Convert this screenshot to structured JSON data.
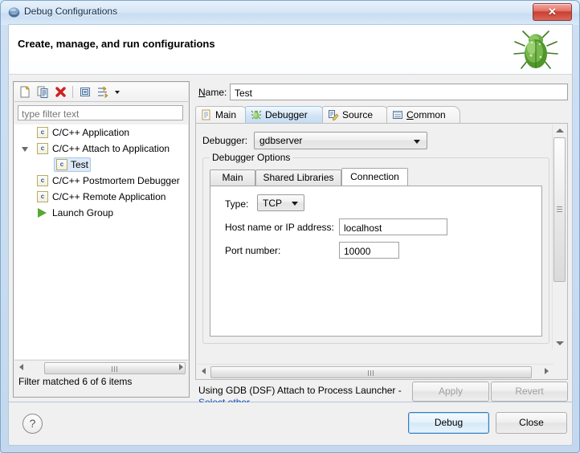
{
  "window": {
    "title": "Debug Configurations",
    "icon": "eclipse-sphere-icon",
    "close_label": "✕"
  },
  "banner": {
    "title": "Create, manage, and run configurations",
    "icon": "green-bug-icon"
  },
  "left_panel": {
    "toolbar": [
      {
        "name": "new-configuration-icon",
        "tooltip": "New launch configuration"
      },
      {
        "name": "duplicate-configuration-icon",
        "tooltip": "Duplicate"
      },
      {
        "name": "delete-configuration-icon",
        "tooltip": "Delete"
      },
      {
        "name": "collapse-all-icon",
        "tooltip": "Collapse All"
      },
      {
        "name": "filter-icon",
        "tooltip": "Filter launch configurations"
      },
      {
        "name": "chevron-down-icon",
        "tooltip": "View Menu"
      }
    ],
    "filter_placeholder": "type filter text",
    "filter_value": "",
    "tree": [
      {
        "label": "C/C++ Application",
        "icon": "c-config-icon",
        "indent": 0,
        "expandable": false,
        "selected": false
      },
      {
        "label": "C/C++ Attach to Application",
        "icon": "c-config-icon",
        "indent": 0,
        "expandable": true,
        "expanded": true,
        "selected": false
      },
      {
        "label": "Test",
        "icon": "c-config-icon",
        "indent": 1,
        "expandable": false,
        "selected": true
      },
      {
        "label": "C/C++ Postmortem Debugger",
        "icon": "c-config-icon",
        "indent": 0,
        "expandable": false,
        "selected": false
      },
      {
        "label": "C/C++ Remote Application",
        "icon": "c-config-icon",
        "indent": 0,
        "expandable": false,
        "selected": false
      },
      {
        "label": "Launch Group",
        "icon": "launch-group-icon",
        "indent": 0,
        "expandable": false,
        "selected": false
      }
    ],
    "status": "Filter matched 6 of 6 items"
  },
  "right_panel": {
    "name_label": "Name:",
    "name_value": "Test",
    "tabs": [
      {
        "label": "Main",
        "icon": "document-icon",
        "active": false
      },
      {
        "label": "Debugger",
        "icon": "bug-icon",
        "active": true
      },
      {
        "label": "Source",
        "icon": "source-icon",
        "active": false
      },
      {
        "label": "Common",
        "icon": "common-grid-icon",
        "active": false
      }
    ],
    "debugger_label": "Debugger:",
    "debugger_value": "gdbserver",
    "group_title": "Debugger Options",
    "inner_tabs": [
      {
        "label": "Main",
        "active": false
      },
      {
        "label": "Shared Libraries",
        "active": false
      },
      {
        "label": "Connection",
        "active": true
      }
    ],
    "fields": {
      "type_label": "Type:",
      "type_value": "TCP",
      "host_label": "Host name or IP address:",
      "host_value": "localhost",
      "port_label": "Port number:",
      "port_value": "10000"
    },
    "status_text": "Using GDB (DSF) Attach to Process Launcher -",
    "status_link": "Select other...",
    "apply_label": "Apply",
    "revert_label": "Revert"
  },
  "footer": {
    "help_label": "?",
    "debug_label": "Debug",
    "close_label": "Close"
  },
  "colors": {
    "accent": "#2f7cc4",
    "link": "#1a4fb4",
    "titlebar": "#d7e7f7",
    "close_button": "#c93f32",
    "selection": "#dceaf8"
  }
}
